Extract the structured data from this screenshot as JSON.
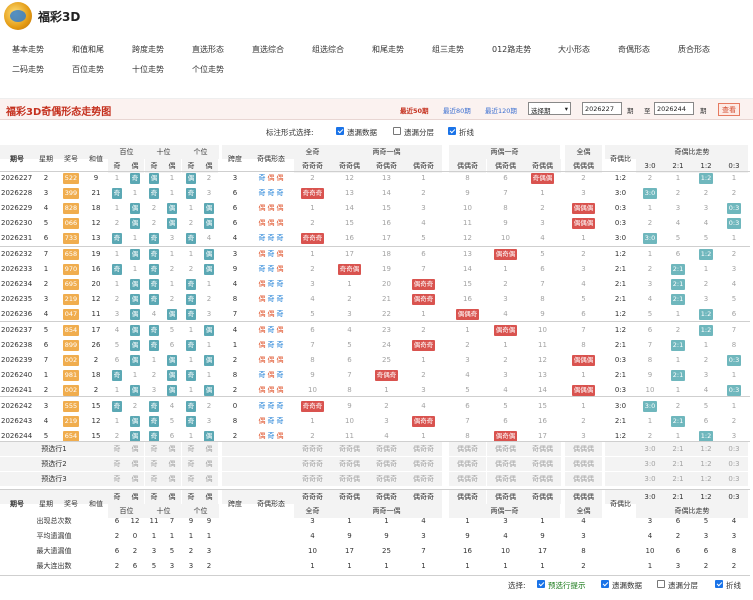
{
  "app": {
    "title": "福彩3D"
  },
  "nav": {
    "row1": [
      "基本走势",
      "和值和尾",
      "跨度走势",
      "直选形态",
      "直选综合",
      "组选综合",
      "和尾走势",
      "组三走势",
      "012路走势",
      "大小形态",
      "奇偶形态",
      "质合形态"
    ],
    "row2": [
      "二码走势",
      "百位走势",
      "十位走势",
      "个位走势"
    ]
  },
  "caption": {
    "title": "福彩3D奇偶形态走势图",
    "recent50": "最近50期",
    "recent80": "最近80期",
    "recent120": "最近120期",
    "select_period": "选择期",
    "from": "2026227",
    "to_label": "期",
    "to_sep": "至",
    "to": "2026244",
    "to_label2": "期",
    "query": "查看"
  },
  "options": {
    "label": "标注形式选择:",
    "miss": "遗漏数据",
    "layer": "遗漏分层",
    "line": "折线"
  },
  "header": {
    "issue": "期号",
    "week": "星期",
    "prize": "奖号",
    "sum": "和值",
    "bai": "百位",
    "shi": "十位",
    "ge": "个位",
    "odd": "奇",
    "even": "偶",
    "span": "跨度",
    "form": "奇偶形态",
    "all_odd": "全奇",
    "two_odd_one_even": "两奇一偶",
    "two_even_one_odd": "两偶一奇",
    "all_even": "全偶",
    "ratio": "奇偶比",
    "ratio_trend": "奇偶比走势",
    "sub": [
      "奇奇奇",
      "奇奇偶",
      "奇偶奇",
      "偶奇奇",
      "偶偶奇",
      "偶奇偶",
      "奇偶偶",
      "偶偶偶"
    ],
    "ratio_sub": [
      "3:0",
      "2:1",
      "1:2",
      "0:3"
    ]
  },
  "rows": [
    {
      "issue": "2026227",
      "week": "2",
      "prize": "522",
      "sum": "9",
      "pos": [
        [
          "1",
          "奇"
        ],
        [
          "偶",
          "1"
        ],
        [
          "偶",
          "2"
        ]
      ],
      "span": "3",
      "form": [
        "奇",
        "偶",
        "偶"
      ],
      "pat": [
        "2",
        "12",
        "13",
        "1",
        "8",
        "6",
        "奇偶偶",
        "2"
      ],
      "ratio": "1:2",
      "rt": [
        "2",
        "1",
        "1:2",
        "1"
      ]
    },
    {
      "issue": "2026228",
      "week": "3",
      "prize": "399",
      "sum": "21",
      "pos": [
        [
          "奇",
          "1"
        ],
        [
          "奇",
          "1"
        ],
        [
          "奇",
          "3"
        ]
      ],
      "span": "6",
      "form": [
        "奇",
        "奇",
        "奇"
      ],
      "pat": [
        "奇奇奇",
        "13",
        "14",
        "2",
        "9",
        "7",
        "1",
        "3"
      ],
      "ratio": "3:0",
      "rt": [
        "3:0",
        "2",
        "2",
        "2"
      ]
    },
    {
      "issue": "2026229",
      "week": "4",
      "prize": "828",
      "sum": "18",
      "pos": [
        [
          "1",
          "偶"
        ],
        [
          "2",
          "偶"
        ],
        [
          "1",
          "偶"
        ]
      ],
      "span": "6",
      "form": [
        "偶",
        "偶",
        "偶"
      ],
      "pat": [
        "1",
        "14",
        "15",
        "3",
        "10",
        "8",
        "2",
        "偶偶偶"
      ],
      "ratio": "0:3",
      "rt": [
        "1",
        "3",
        "3",
        "0:3"
      ]
    },
    {
      "issue": "2026230",
      "week": "5",
      "prize": "066",
      "sum": "12",
      "pos": [
        [
          "2",
          "偶"
        ],
        [
          "2",
          "偶"
        ],
        [
          "2",
          "偶"
        ]
      ],
      "span": "6",
      "form": [
        "偶",
        "偶",
        "偶"
      ],
      "pat": [
        "2",
        "15",
        "16",
        "4",
        "11",
        "9",
        "3",
        "偶偶偶"
      ],
      "ratio": "0:3",
      "rt": [
        "2",
        "4",
        "4",
        "0:3"
      ]
    },
    {
      "issue": "2026231",
      "week": "6",
      "prize": "733",
      "sum": "13",
      "pos": [
        [
          "奇",
          "1"
        ],
        [
          "奇",
          "3"
        ],
        [
          "奇",
          "4"
        ]
      ],
      "span": "4",
      "form": [
        "奇",
        "奇",
        "奇"
      ],
      "pat": [
        "奇奇奇",
        "16",
        "17",
        "5",
        "12",
        "10",
        "4",
        "1"
      ],
      "ratio": "3:0",
      "rt": [
        "3:0",
        "5",
        "5",
        "1"
      ]
    },
    {
      "issue": "2026232",
      "week": "7",
      "prize": "658",
      "sum": "19",
      "pos": [
        [
          "1",
          "偶"
        ],
        [
          "奇",
          "1"
        ],
        [
          "1",
          "偶"
        ]
      ],
      "span": "3",
      "form": [
        "偶",
        "奇",
        "偶"
      ],
      "pat": [
        "1",
        "17",
        "18",
        "6",
        "13",
        "偶奇偶",
        "5",
        "2"
      ],
      "ratio": "1:2",
      "rt": [
        "1",
        "6",
        "1:2",
        "2"
      ]
    },
    {
      "issue": "2026233",
      "week": "1",
      "prize": "970",
      "sum": "16",
      "pos": [
        [
          "奇",
          "1"
        ],
        [
          "奇",
          "2"
        ],
        [
          "2",
          "偶"
        ]
      ],
      "span": "9",
      "form": [
        "奇",
        "奇",
        "偶"
      ],
      "pat": [
        "2",
        "奇奇偶",
        "19",
        "7",
        "14",
        "1",
        "6",
        "3"
      ],
      "ratio": "2:1",
      "rt": [
        "2",
        "2:1",
        "1",
        "3"
      ]
    },
    {
      "issue": "2026234",
      "week": "2",
      "prize": "695",
      "sum": "20",
      "pos": [
        [
          "1",
          "偶"
        ],
        [
          "奇",
          "1"
        ],
        [
          "奇",
          "1"
        ]
      ],
      "span": "4",
      "form": [
        "偶",
        "奇",
        "奇"
      ],
      "pat": [
        "3",
        "1",
        "20",
        "偶奇奇",
        "15",
        "2",
        "7",
        "4"
      ],
      "ratio": "2:1",
      "rt": [
        "3",
        "2:1",
        "2",
        "4"
      ]
    },
    {
      "issue": "2026235",
      "week": "3",
      "prize": "219",
      "sum": "12",
      "pos": [
        [
          "2",
          "偶"
        ],
        [
          "奇",
          "2"
        ],
        [
          "奇",
          "2"
        ]
      ],
      "span": "8",
      "form": [
        "偶",
        "奇",
        "奇"
      ],
      "pat": [
        "4",
        "2",
        "21",
        "偶奇奇",
        "16",
        "3",
        "8",
        "5"
      ],
      "ratio": "2:1",
      "rt": [
        "4",
        "2:1",
        "3",
        "5"
      ]
    },
    {
      "issue": "2026236",
      "week": "4",
      "prize": "047",
      "sum": "11",
      "pos": [
        [
          "3",
          "偶"
        ],
        [
          "4",
          "偶"
        ],
        [
          "奇",
          "3"
        ]
      ],
      "span": "7",
      "form": [
        "偶",
        "偶",
        "奇"
      ],
      "pat": [
        "5",
        "3",
        "22",
        "1",
        "偶偶奇",
        "4",
        "9",
        "6"
      ],
      "ratio": "1:2",
      "rt": [
        "5",
        "1",
        "1:2",
        "6"
      ]
    },
    {
      "issue": "2026237",
      "week": "5",
      "prize": "854",
      "sum": "17",
      "pos": [
        [
          "4",
          "偶"
        ],
        [
          "奇",
          "5"
        ],
        [
          "1",
          "偶"
        ]
      ],
      "span": "4",
      "form": [
        "偶",
        "奇",
        "偶"
      ],
      "pat": [
        "6",
        "4",
        "23",
        "2",
        "1",
        "偶奇偶",
        "10",
        "7"
      ],
      "ratio": "1:2",
      "rt": [
        "6",
        "2",
        "1:2",
        "7"
      ]
    },
    {
      "issue": "2026238",
      "week": "6",
      "prize": "899",
      "sum": "26",
      "pos": [
        [
          "5",
          "偶"
        ],
        [
          "奇",
          "6"
        ],
        [
          "奇",
          "1"
        ]
      ],
      "span": "1",
      "form": [
        "偶",
        "奇",
        "奇"
      ],
      "pat": [
        "7",
        "5",
        "24",
        "偶奇奇",
        "2",
        "1",
        "11",
        "8"
      ],
      "ratio": "2:1",
      "rt": [
        "7",
        "2:1",
        "1",
        "8"
      ]
    },
    {
      "issue": "2026239",
      "week": "7",
      "prize": "002",
      "sum": "2",
      "pos": [
        [
          "6",
          "偶"
        ],
        [
          "1",
          "偶"
        ],
        [
          "1",
          "偶"
        ]
      ],
      "span": "2",
      "form": [
        "偶",
        "偶",
        "偶"
      ],
      "pat": [
        "8",
        "6",
        "25",
        "1",
        "3",
        "2",
        "12",
        "偶偶偶"
      ],
      "ratio": "0:3",
      "rt": [
        "8",
        "1",
        "2",
        "0:3"
      ]
    },
    {
      "issue": "2026240",
      "week": "1",
      "prize": "981",
      "sum": "18",
      "pos": [
        [
          "奇",
          "1"
        ],
        [
          "2",
          "偶"
        ],
        [
          "奇",
          "1"
        ]
      ],
      "span": "8",
      "form": [
        "奇",
        "偶",
        "奇"
      ],
      "pat": [
        "9",
        "7",
        "奇偶奇",
        "2",
        "4",
        "3",
        "13",
        "1"
      ],
      "ratio": "2:1",
      "rt": [
        "9",
        "2:1",
        "3",
        "1"
      ]
    },
    {
      "issue": "2026241",
      "week": "2",
      "prize": "002",
      "sum": "2",
      "pos": [
        [
          "1",
          "偶"
        ],
        [
          "3",
          "偶"
        ],
        [
          "1",
          "偶"
        ]
      ],
      "span": "2",
      "form": [
        "偶",
        "偶",
        "偶"
      ],
      "pat": [
        "10",
        "8",
        "1",
        "3",
        "5",
        "4",
        "14",
        "偶偶偶"
      ],
      "ratio": "0:3",
      "rt": [
        "10",
        "1",
        "4",
        "0:3"
      ]
    },
    {
      "issue": "2026242",
      "week": "3",
      "prize": "555",
      "sum": "15",
      "pos": [
        [
          "奇",
          "2"
        ],
        [
          "奇",
          "4"
        ],
        [
          "奇",
          "2"
        ]
      ],
      "span": "0",
      "form": [
        "奇",
        "奇",
        "奇"
      ],
      "pat": [
        "奇奇奇",
        "9",
        "2",
        "4",
        "6",
        "5",
        "15",
        "1"
      ],
      "ratio": "3:0",
      "rt": [
        "3:0",
        "2",
        "5",
        "1"
      ]
    },
    {
      "issue": "2026243",
      "week": "4",
      "prize": "219",
      "sum": "12",
      "pos": [
        [
          "1",
          "偶"
        ],
        [
          "奇",
          "5"
        ],
        [
          "奇",
          "3"
        ]
      ],
      "span": "8",
      "form": [
        "偶",
        "奇",
        "奇"
      ],
      "pat": [
        "1",
        "10",
        "3",
        "偶奇奇",
        "7",
        "6",
        "16",
        "2"
      ],
      "ratio": "2:1",
      "rt": [
        "1",
        "2:1",
        "6",
        "2"
      ]
    },
    {
      "issue": "2026244",
      "week": "5",
      "prize": "654",
      "sum": "15",
      "pos": [
        [
          "2",
          "偶"
        ],
        [
          "奇",
          "6"
        ],
        [
          "1",
          "偶"
        ]
      ],
      "span": "2",
      "form": [
        "偶",
        "奇",
        "偶"
      ],
      "pat": [
        "2",
        "11",
        "4",
        "1",
        "8",
        "偶奇偶",
        "17",
        "3"
      ],
      "ratio": "1:2",
      "rt": [
        "2",
        "1",
        "1:2",
        "3"
      ]
    }
  ],
  "predict": {
    "labels": [
      "预选行1",
      "预选行2",
      "预选行3"
    ],
    "cells": [
      "奇",
      "偶",
      "奇",
      "偶",
      "奇",
      "偶"
    ],
    "pat": [
      "奇奇奇",
      "奇奇偶",
      "奇偶奇",
      "偶奇奇",
      "偶偶奇",
      "偶奇偶",
      "奇偶偶",
      "偶偶偶"
    ],
    "rt": [
      "3:0",
      "2:1",
      "1:2",
      "0:3"
    ]
  },
  "stats": [
    {
      "label": "出现总次数",
      "pos": [
        "6",
        "12",
        "11",
        "7",
        "9",
        "9"
      ],
      "pat": [
        "3",
        "1",
        "1",
        "4",
        "1",
        "3",
        "1",
        "4"
      ],
      "rt": [
        "3",
        "6",
        "5",
        "4"
      ]
    },
    {
      "label": "平均遗漏值",
      "pos": [
        "2",
        "0",
        "1",
        "1",
        "1",
        "1"
      ],
      "pat": [
        "4",
        "9",
        "9",
        "3",
        "9",
        "4",
        "9",
        "3"
      ],
      "rt": [
        "4",
        "2",
        "3",
        "3"
      ]
    },
    {
      "label": "最大遗漏值",
      "pos": [
        "6",
        "2",
        "3",
        "5",
        "2",
        "3"
      ],
      "pat": [
        "10",
        "17",
        "25",
        "7",
        "16",
        "10",
        "17",
        "8"
      ],
      "rt": [
        "10",
        "6",
        "6",
        "8"
      ]
    },
    {
      "label": "最大连出数",
      "pos": [
        "2",
        "6",
        "5",
        "3",
        "3",
        "2"
      ],
      "pat": [
        "1",
        "1",
        "1",
        "1",
        "1",
        "1",
        "1",
        "2"
      ],
      "rt": [
        "1",
        "3",
        "2",
        "2"
      ]
    }
  ],
  "footer": {
    "label": "选择:",
    "predict": "预选行提示",
    "miss": "遗漏数据",
    "layer": "遗漏分层",
    "line": "折线"
  },
  "colors": {
    "prize": "#f0ad4e",
    "odd_even": "#5ba8b4",
    "pattern": "#d9534f",
    "ratio": "#6fb7bd",
    "accent": "#c5311f"
  }
}
